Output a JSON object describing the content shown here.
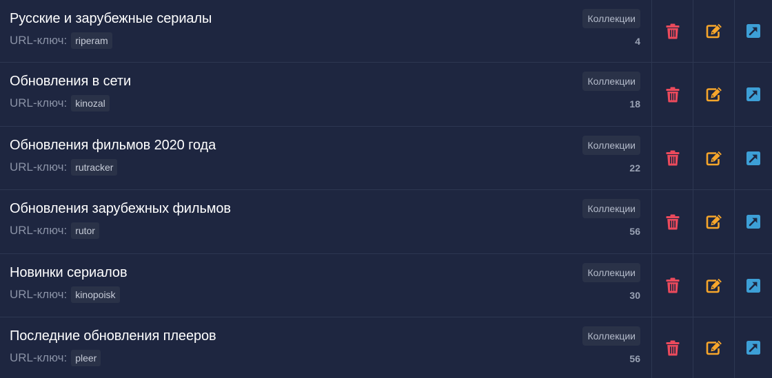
{
  "labels": {
    "url_key": "URL-ключ:",
    "badge": "Коллекции"
  },
  "colors": {
    "delete": "#ec4a5c",
    "edit": "#f7a62b",
    "open": "#3d9fd6"
  },
  "icons": {
    "delete": "trash-icon",
    "edit": "edit-icon",
    "open": "external-link-icon"
  },
  "rows": [
    {
      "title": "Русские и зарубежные сериалы",
      "key": "riperam",
      "count": "4"
    },
    {
      "title": "Обновления в сети",
      "key": "kinozal",
      "count": "18"
    },
    {
      "title": "Обновления фильмов 2020 года",
      "key": "rutracker",
      "count": "22"
    },
    {
      "title": "Обновления зарубежных фильмов",
      "key": "rutor",
      "count": "56"
    },
    {
      "title": "Новинки сериалов",
      "key": "kinopoisk",
      "count": "30"
    },
    {
      "title": "Последние обновления плееров",
      "key": "pleer",
      "count": "56"
    }
  ]
}
